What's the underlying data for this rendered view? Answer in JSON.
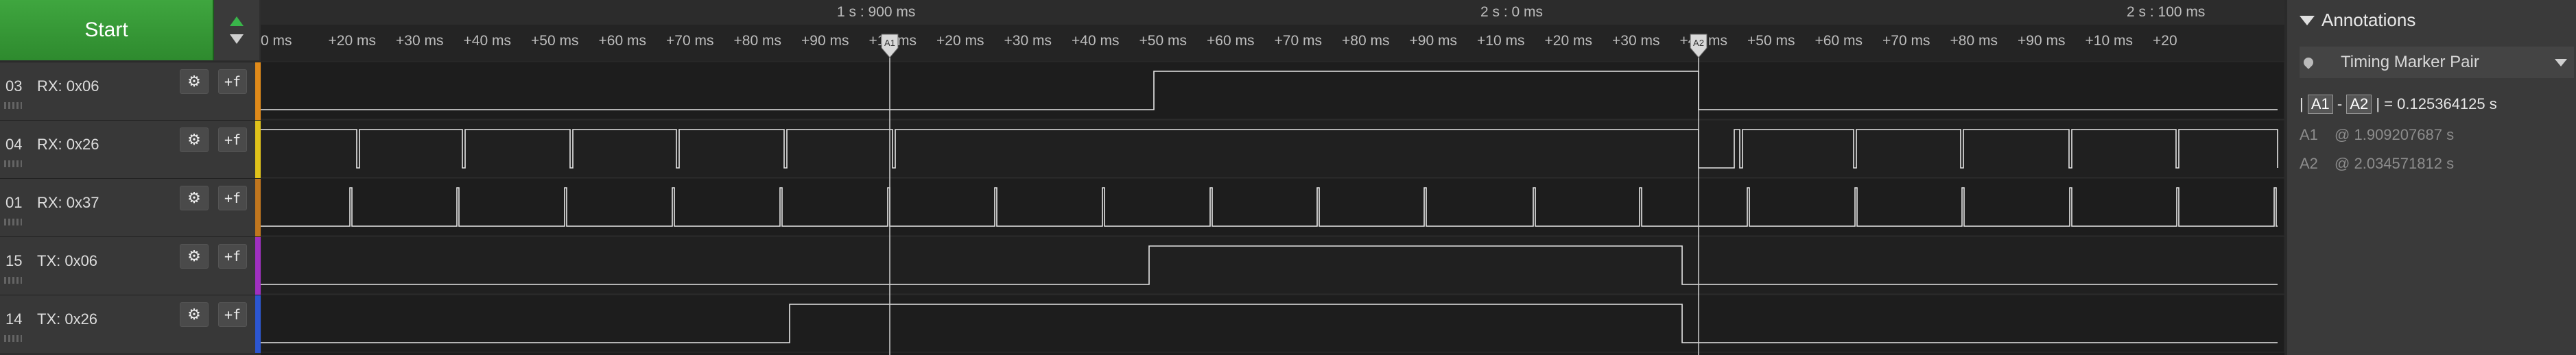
{
  "start_button": {
    "label": "Start"
  },
  "channels": [
    {
      "num": "03",
      "name": "RX: 0x06",
      "color": "#e08a1a"
    },
    {
      "num": "04",
      "name": "RX: 0x26",
      "color": "#e0c21a"
    },
    {
      "num": "01",
      "name": "RX: 0x37",
      "color": "#c0761e"
    },
    {
      "num": "15",
      "name": "TX: 0x06",
      "color": "#a030c0"
    },
    {
      "num": "14",
      "name": "TX: 0x26",
      "color": "#2c56d0"
    }
  ],
  "ruler": {
    "major": [
      {
        "label": "1 s : 900 ms"
      },
      {
        "label": "2 s : 0 ms"
      },
      {
        "label": "2 s : 100 ms"
      }
    ],
    "minor": [
      "0 ms",
      "+20 ms",
      "+30 ms",
      "+40 ms",
      "+50 ms",
      "+60 ms",
      "+70 ms",
      "+80 ms",
      "+90 ms",
      "+10 ms",
      "+20 ms",
      "+30 ms",
      "+40 ms",
      "+50 ms",
      "+60 ms",
      "+70 ms",
      "+80 ms",
      "+90 ms",
      "+10 ms",
      "+20 ms",
      "+30 ms",
      "+40 ms",
      "+50 ms",
      "+60 ms",
      "+70 ms",
      "+80 ms",
      "+90 ms",
      "+10 ms",
      "+20"
    ]
  },
  "markers": {
    "a1_label": "A1",
    "a2_label": "A2"
  },
  "annotations": {
    "title": "Annotations",
    "pair_title": "Timing Marker Pair",
    "delta_label": "= 0.125364125 s",
    "a1_text": "@  1.909207687 s",
    "a2_text": "@  2.034571812 s"
  }
}
